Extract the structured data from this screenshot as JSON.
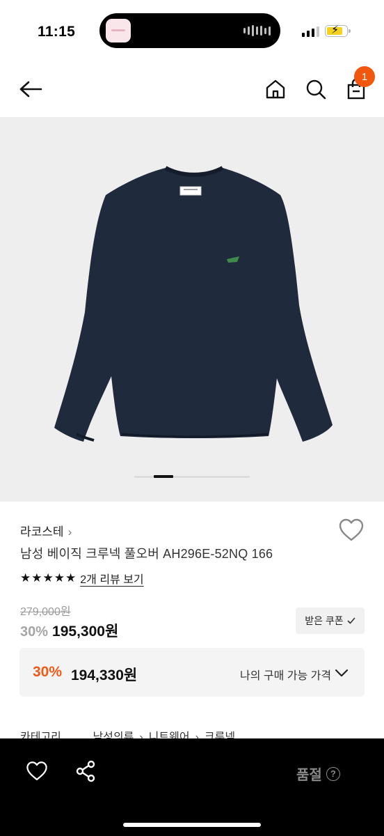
{
  "status_bar": {
    "time": "11:15",
    "icons": [
      "signal-icon",
      "battery-charging-icon"
    ]
  },
  "nav": {
    "icons": [
      "back-arrow-icon",
      "home-icon",
      "search-icon",
      "shopping-bag-icon"
    ],
    "cart_count": "1",
    "badge_color": "#f2570f"
  },
  "product": {
    "brand": "라코스테",
    "name": "남성 베이직 크루넥 풀오버 AH296E-52NQ 166",
    "rating_stars": 5,
    "review_link": "2개 리뷰 보기",
    "original_price": "279,000원",
    "discount_percent": "30%",
    "sale_price": "195,300원",
    "coupon_button": "받은 쿠폰",
    "my_price": {
      "percent": "30%",
      "price": "194,330원",
      "label": "나의 구매 가능 가격"
    },
    "category": {
      "label": "카테고리",
      "path": [
        "남성의류",
        "니트웨어",
        "크루넥"
      ]
    },
    "image": {
      "description_icon": "navy-crewneck-sweater",
      "garment_color": "#1f2a3c",
      "background_color": "#eeeeee"
    },
    "carousel": {
      "current_fraction": 0.2
    }
  },
  "bottom_bar": {
    "soldout_label": "품절",
    "icons": [
      "heart-icon",
      "share-icon",
      "help-icon"
    ]
  },
  "colors": {
    "accent_orange": "#ef5a18",
    "text_dark": "#111111"
  }
}
